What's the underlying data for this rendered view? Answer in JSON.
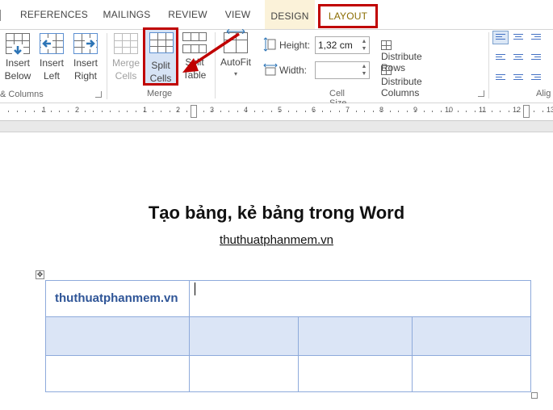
{
  "tabs": [
    "REFERENCES",
    "MAILINGS",
    "REVIEW",
    "VIEW",
    "DESIGN",
    "LAYOUT"
  ],
  "ribbon": {
    "rows_columns": {
      "insert_below": [
        "Insert",
        "Below"
      ],
      "insert_left": [
        "Insert",
        "Left"
      ],
      "insert_right": [
        "Insert",
        "Right"
      ],
      "group_label": "& Columns"
    },
    "merge": {
      "merge_cells": [
        "Merge",
        "Cells"
      ],
      "split_cells": [
        "Split",
        "Cells"
      ],
      "split_table": [
        "Split",
        "Table"
      ],
      "group_label": "Merge"
    },
    "cell_size": {
      "autofit": "AutoFit",
      "height_label": "Height:",
      "height_value": "1,32 cm",
      "width_label": "Width:",
      "width_value": "",
      "distribute_rows": "Distribute Rows",
      "distribute_columns": "Distribute Columns",
      "group_label": "Cell Size"
    },
    "alignment": {
      "group_label": "Alig"
    }
  },
  "ruler": {
    "numbers": [
      "1",
      "2",
      "1",
      "2",
      "3",
      "4",
      "5",
      "6",
      "7",
      "8",
      "9",
      "10",
      "11",
      "12",
      "13"
    ]
  },
  "document": {
    "title": "Tạo bảng, kẻ bảng trong Word",
    "subtitle": "thuthuatphanmem.vn",
    "table": {
      "cell_text": "thuthuatphanmem.vn"
    }
  },
  "colors": {
    "highlight_red": "#c00000",
    "table_border": "#8eaadb",
    "table_shade": "#dbe5f6",
    "cell_text": "#2f5597",
    "design_tab_bg": "#fbf2d9"
  }
}
